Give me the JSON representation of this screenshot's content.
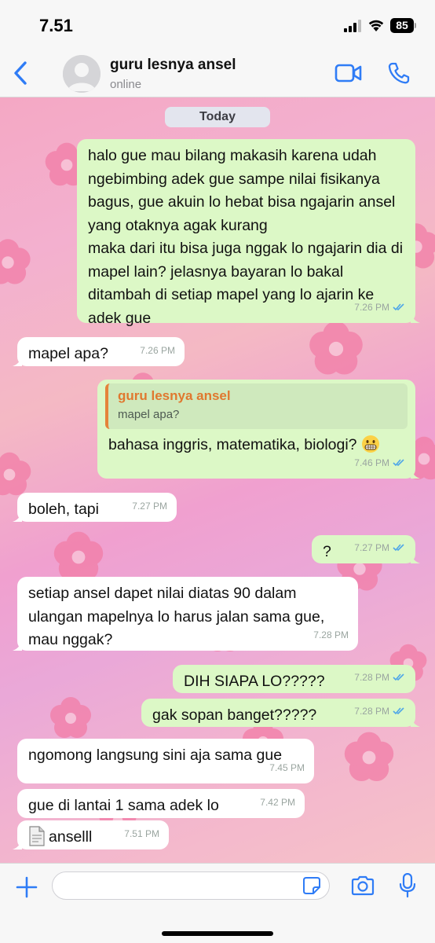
{
  "status_bar": {
    "time": "7.51",
    "battery": "85"
  },
  "header": {
    "contact_name": "guru lesnya ansel",
    "contact_status": "online"
  },
  "chat": {
    "date_label": "Today",
    "messages": [
      {
        "direction": "out",
        "text": "halo gue mau bilang makasih karena udah ngebimbing adek gue sampe nilai fisikanya bagus, gue akuin lo hebat bisa ngajarin ansel yang otaknya agak kurang\nmaka dari itu bisa juga nggak lo ngajarin dia di mapel lain? jelasnya bayaran lo bakal ditambah di setiap mapel yang lo ajarin ke adek gue",
        "time": "7.26 PM",
        "read": true
      },
      {
        "direction": "in",
        "text": "mapel apa?",
        "time": "7.26 PM"
      },
      {
        "direction": "out",
        "reply_to_name": "guru lesnya ansel",
        "reply_to_text": "mapel apa?",
        "text": "bahasa inggris, matematika, biologi?",
        "emoji": "grimacing-face",
        "time": "7.46 PM",
        "read": true
      },
      {
        "direction": "in",
        "text": "boleh, tapi",
        "time": "7.27 PM"
      },
      {
        "direction": "out",
        "text": "?",
        "time": "7.27 PM",
        "read": true
      },
      {
        "direction": "in",
        "text": "setiap ansel dapet nilai diatas 90 dalam ulangan mapelnya lo harus jalan sama gue, mau nggak?",
        "time": "7.28 PM"
      },
      {
        "direction": "out",
        "text": "DIH SIAPA LO?????",
        "time": "7.28 PM",
        "read": true
      },
      {
        "direction": "out",
        "text": "gak sopan banget?????",
        "time": "7.28 PM",
        "read": true
      },
      {
        "direction": "in",
        "text": "ngomong langsung sini aja sama gue",
        "time": "7.45 PM"
      },
      {
        "direction": "in",
        "text": "gue di lantai 1 sama adek lo",
        "time": "7.42 PM"
      },
      {
        "direction": "in",
        "attachment_icon": "document-icon",
        "text": "anselll",
        "time": "7.51 PM"
      }
    ]
  },
  "input_bar": {
    "placeholder": ""
  },
  "colors": {
    "accent": "#2f7cf6",
    "outgoing_bubble": "#dcf8c6",
    "incoming_bubble": "#ffffff",
    "read_ticks": "#4fa6e8",
    "quote_name": "#e0782f"
  }
}
